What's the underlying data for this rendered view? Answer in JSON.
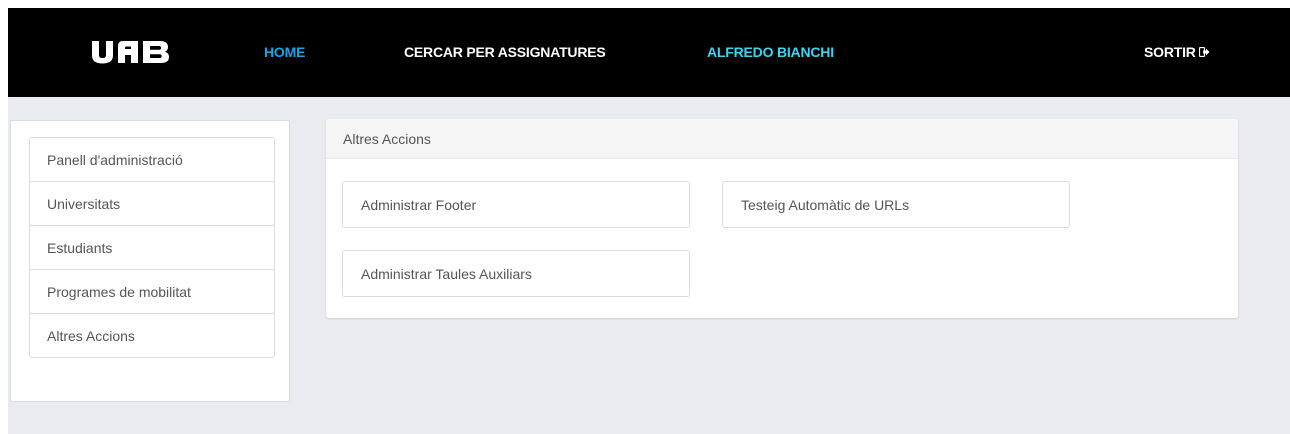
{
  "header": {
    "logo_text": "UAB",
    "nav": {
      "home": {
        "label": "HOME",
        "color": "#1aa3e8"
      },
      "search": {
        "label": "CERCAR PER ASSIGNATURES",
        "color": "#ffffff"
      },
      "user": {
        "label": "ALFREDO BIANCHI",
        "color": "#3dd5f3"
      },
      "logout": {
        "label": "SORTIR",
        "color": "#ffffff",
        "icon": "logout-icon"
      }
    }
  },
  "sidebar": {
    "items": [
      {
        "label": "Panell d'administració"
      },
      {
        "label": "Universitats"
      },
      {
        "label": "Estudiants"
      },
      {
        "label": "Programes de mobilitat"
      },
      {
        "label": "Altres Accions"
      }
    ]
  },
  "main": {
    "panel_title": "Altres Accions",
    "actions": {
      "footer": "Administrar Footer",
      "urls": "Testeig Automàtic de URLs",
      "taules": "Administrar Taules Auxiliars"
    }
  },
  "colors": {
    "topbar": "#000000",
    "background": "#e8ecf0",
    "text": "#555555"
  }
}
